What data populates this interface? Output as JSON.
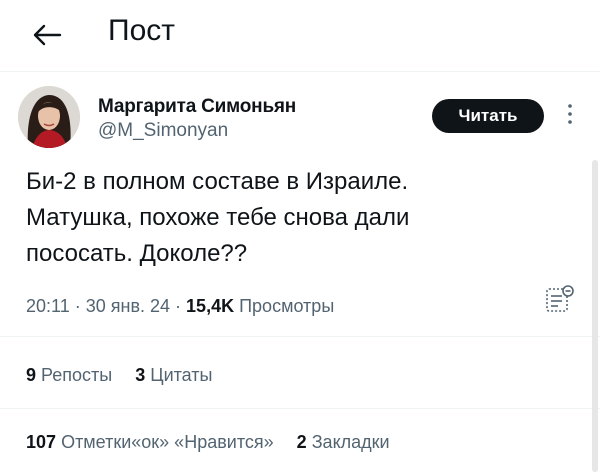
{
  "header": {
    "title": "Пост",
    "back_icon": "arrow-left-icon"
  },
  "tweet": {
    "author_name": "Маргарита Симоньян",
    "author_handle": "@M_Simonyan",
    "follow_label": "Читать",
    "text_lines": [
      "Би-2 в полном составе в Израиле.",
      "Матушка, похоже тебе снова дали",
      "пососать. Доколе??"
    ],
    "time": "20:11",
    "date": "30 янв. 24",
    "views_count": "15,4K",
    "views_label": "Просмотры",
    "reposts_count": "9",
    "reposts_label": "Репосты",
    "quotes_count": "3",
    "quotes_label": "Цитаты",
    "likes_count": "107",
    "likes_label": "Отметки«ок» «Нравится»",
    "bookmarks_count": "2",
    "bookmarks_label": "Закладки"
  },
  "colors": {
    "text": "#0f1419",
    "secondary": "#536471",
    "button_bg": "#0f1419",
    "separator": "#eff3f4"
  }
}
